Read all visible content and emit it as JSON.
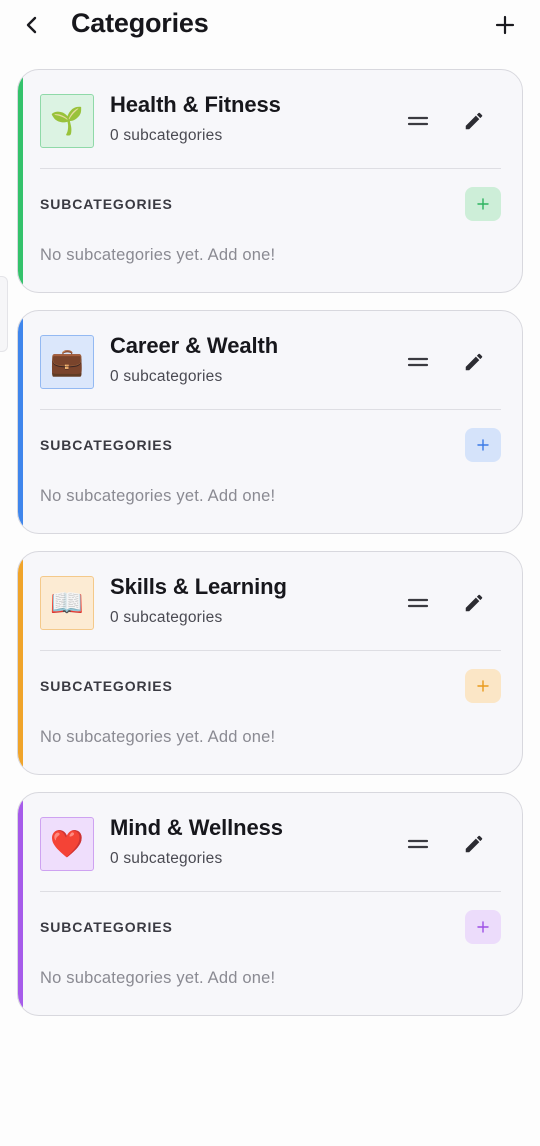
{
  "header": {
    "title": "Categories",
    "back_icon": "chevron-left-icon",
    "add_icon": "plus-icon"
  },
  "categories": [
    {
      "name": "Health & Fitness",
      "subcount": "0 subcategories",
      "emoji": "🌱",
      "accent": "#34c26b",
      "tile_bg": "#dcf3e3",
      "tile_border": "#8fd9a8",
      "add_bg": "#cdeed8",
      "add_fg": "#2db35f",
      "sub_heading": "SUBCATEGORIES",
      "empty": "No subcategories yet. Add one!"
    },
    {
      "name": "Career & Wealth",
      "subcount": "0 subcategories",
      "emoji": "💼",
      "accent": "#3f86ec",
      "tile_bg": "#dbe7fb",
      "tile_border": "#93b9f2",
      "add_bg": "#d5e3fa",
      "add_fg": "#3b7ae6",
      "sub_heading": "SUBCATEGORIES",
      "empty": "No subcategories yet. Add one!"
    },
    {
      "name": "Skills & Learning",
      "subcount": "0 subcategories",
      "emoji": "📖",
      "accent": "#f0a42a",
      "tile_bg": "#fcebd3",
      "tile_border": "#f4c98a",
      "add_bg": "#fbe6c6",
      "add_fg": "#e99a1b",
      "sub_heading": "SUBCATEGORIES",
      "empty": "No subcategories yet. Add one!"
    },
    {
      "name": "Mind & Wellness",
      "subcount": "0 subcategories",
      "emoji": "❤️",
      "accent": "#a65bea",
      "tile_bg": "#efdefc",
      "tile_border": "#cea2f1",
      "add_bg": "#ecdcfb",
      "add_fg": "#9d4fe5",
      "sub_heading": "SUBCATEGORIES",
      "empty": "No subcategories yet. Add one!"
    }
  ],
  "icons": {
    "drag": "drag-handle-icon",
    "edit": "pencil-icon",
    "sub_add": "plus-icon"
  }
}
